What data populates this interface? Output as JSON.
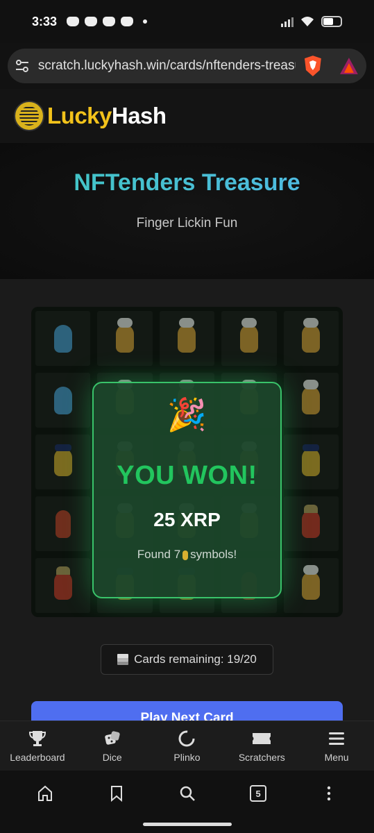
{
  "status_bar": {
    "time": "3:33"
  },
  "browser": {
    "url": "scratch.luckyhash.win/cards/nftenders-treasure",
    "tab_count": "5"
  },
  "site": {
    "brand_part1": "Lucky",
    "brand_part2": "Hash"
  },
  "game": {
    "title": "NFTenders Treasure",
    "subtitle": "Finger Lickin Fun",
    "grid_symbols": [
      [
        "ghost",
        "chef",
        "chef",
        "chef",
        "chef"
      ],
      [
        "ghost",
        "chef",
        "chef",
        "chef",
        "chef"
      ],
      [
        "police",
        "chef",
        "chef",
        "chef",
        "police"
      ],
      [
        "wings",
        "chef",
        "chef",
        "chef",
        "knight"
      ],
      [
        "knight",
        "police",
        "police",
        "wings",
        "chef"
      ]
    ]
  },
  "result": {
    "emoji": "🎉",
    "headline": "YOU WON!",
    "amount": "25 XRP",
    "found_prefix": "Found 7",
    "found_suffix": "symbols!"
  },
  "cards_remaining": "Cards remaining: 19/20",
  "play_button": "Play Next Card",
  "nav": [
    {
      "label": "Leaderboard",
      "icon": "trophy-icon"
    },
    {
      "label": "Dice",
      "icon": "dice-icon"
    },
    {
      "label": "Plinko",
      "icon": "plinko-icon"
    },
    {
      "label": "Scratchers",
      "icon": "ticket-icon"
    },
    {
      "label": "Menu",
      "icon": "menu-icon"
    }
  ]
}
